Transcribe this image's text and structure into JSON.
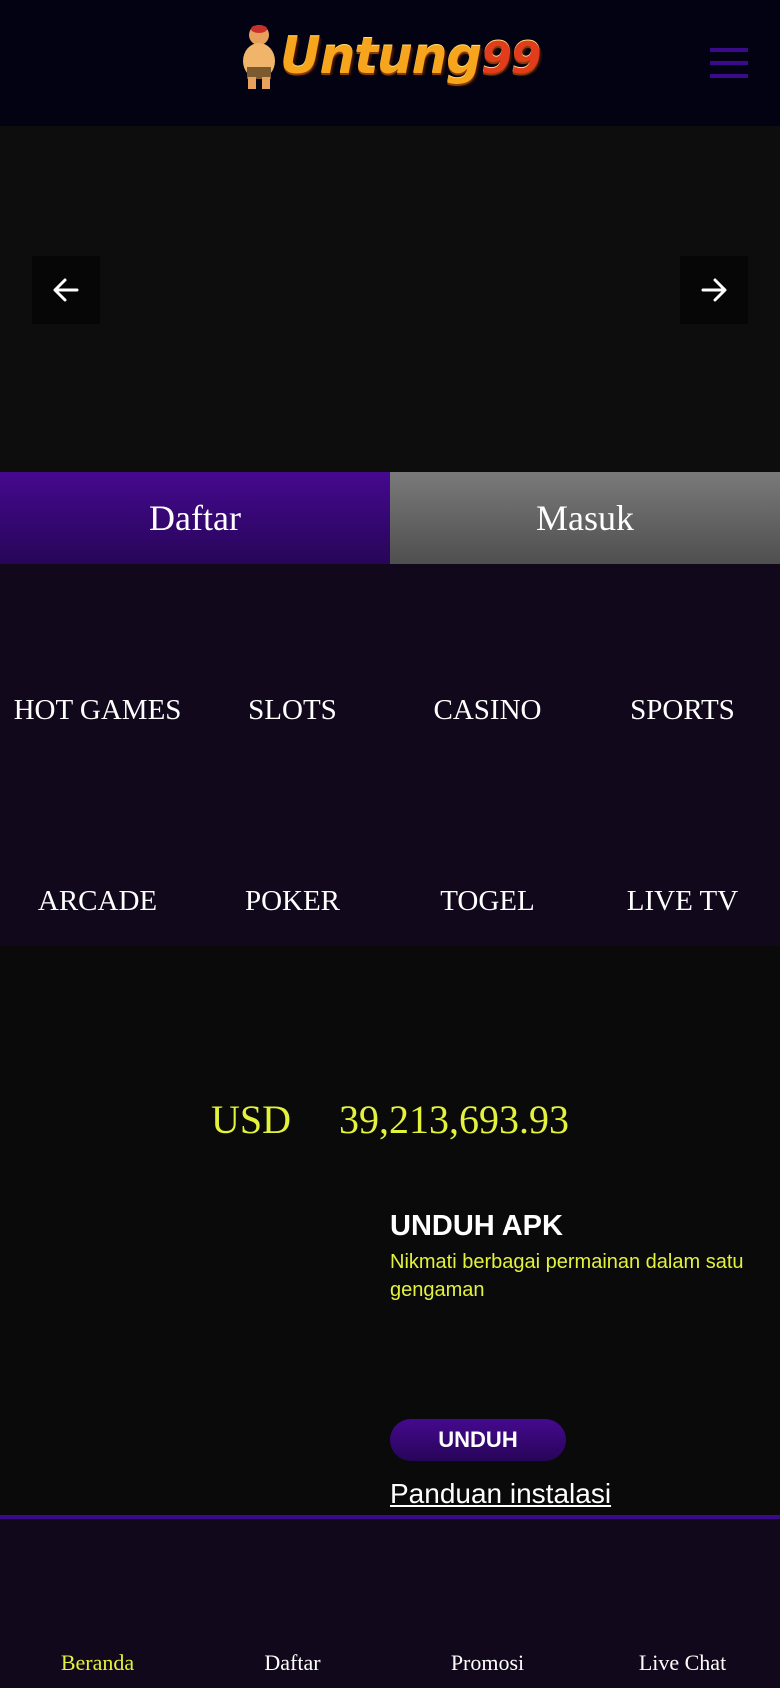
{
  "header": {
    "logo_text": "Untung",
    "logo_number": "99",
    "menu_icon": "hamburger-menu-icon"
  },
  "banner": {
    "prev_icon": "arrow-left-icon",
    "next_icon": "arrow-right-icon"
  },
  "auth": {
    "register_label": "Daftar",
    "login_label": "Masuk"
  },
  "games": {
    "row1": [
      "HOT GAMES",
      "SLOTS",
      "CASINO",
      "SPORTS"
    ],
    "row2": [
      "ARCADE",
      "POKER",
      "TOGEL",
      "LIVE TV"
    ]
  },
  "jackpot": {
    "currency": "USD",
    "amount": "39,213,693.93"
  },
  "apk": {
    "title": "UNDUH APK",
    "description": "Nikmati berbagai permainan dalam satu gengaman",
    "download_label": "UNDUH",
    "guide_link": "Panduan instalasi"
  },
  "bottom_nav": {
    "items": [
      "Beranda",
      "Daftar",
      "Promosi",
      "Live Chat"
    ],
    "active_index": 0
  },
  "colors": {
    "accent_purple": "#3b0a8a",
    "highlight_yellow": "#e3f23a"
  }
}
